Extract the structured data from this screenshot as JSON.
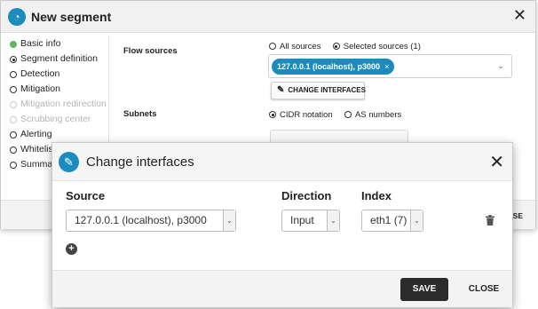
{
  "background_dialog": {
    "title": "New segment",
    "close_glyph": "✕",
    "steps": [
      {
        "label": "Basic info",
        "state": "done"
      },
      {
        "label": "Segment definition",
        "state": "current"
      },
      {
        "label": "Detection",
        "state": "pending"
      },
      {
        "label": "Mitigation",
        "state": "pending"
      },
      {
        "label": "Mitigation redirection",
        "state": "disabled"
      },
      {
        "label": "Scrubbing center",
        "state": "disabled"
      },
      {
        "label": "Alerting",
        "state": "pending"
      },
      {
        "label": "Whitelist",
        "state": "pending"
      },
      {
        "label": "Summary",
        "state": "pending"
      }
    ],
    "flow_sources": {
      "label": "Flow sources",
      "option_all": "All sources",
      "option_selected": "Selected sources (1)",
      "selected_chip": "127.0.0.1 (localhost), p3000",
      "chip_remove_glyph": "×",
      "change_interfaces_label": "CHANGE INTERFACES"
    },
    "subnets": {
      "label": "Subnets",
      "option_cidr": "CIDR notation",
      "option_as": "AS numbers"
    },
    "footer_button_partial": "SE"
  },
  "modal": {
    "title": "Change interfaces",
    "close_glyph": "✕",
    "columns": {
      "source": "Source",
      "direction": "Direction",
      "index": "Index"
    },
    "row": {
      "source": "127.0.0.1 (localhost), p3000",
      "direction": "Input",
      "index": "eth1 (7)"
    },
    "add_glyph": "+",
    "save_label": "SAVE",
    "close_label": "CLOSE"
  },
  "colors": {
    "accent": "#1b8cbe",
    "step_done": "#5cb85c",
    "primary_button": "#2b2b2b"
  }
}
